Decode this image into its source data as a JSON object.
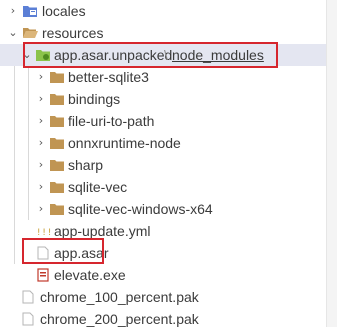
{
  "tree": {
    "locales": "locales",
    "resources": "resources",
    "unpacked_dir": "app.asar.unpacked",
    "path_separator": "\\",
    "node_modules": "node_modules",
    "modules": [
      "better-sqlite3",
      "bindings",
      "file-uri-to-path",
      "onnxruntime-node",
      "sharp",
      "sqlite-vec",
      "sqlite-vec-windows-x64"
    ],
    "app_update": "app-update.yml",
    "app_asar": "app.asar",
    "elevate": "elevate.exe",
    "chrome_100": "chrome_100_percent.pak",
    "chrome_200": "chrome_200_percent.pak"
  },
  "colors": {
    "folder": "#c09553",
    "highlight": "#d6262e",
    "selected_bg": "#e4e6f1"
  },
  "icons": {
    "folder": "folder-icon",
    "file": "file-icon",
    "yaml": "yaml-icon",
    "exe": "exe-icon",
    "package": "package-folder-icon"
  }
}
